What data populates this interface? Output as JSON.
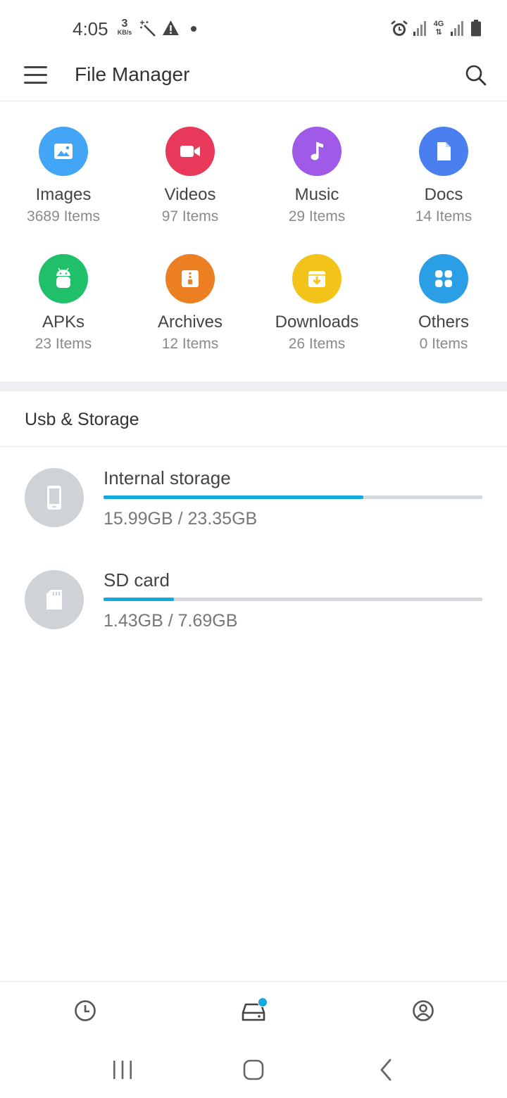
{
  "status_bar": {
    "time": "4:05",
    "net_speed_value": "3",
    "net_speed_unit": "KB/s",
    "network_label": "4G"
  },
  "app_bar": {
    "title": "File Manager"
  },
  "categories": [
    {
      "name": "Images",
      "count": "3689 Items",
      "color": "#42a5f5",
      "icon": "image-icon"
    },
    {
      "name": "Videos",
      "count": "97 Items",
      "color": "#e8395a",
      "icon": "video-icon"
    },
    {
      "name": "Music",
      "count": "29 Items",
      "color": "#a05ae8",
      "icon": "music-note-icon"
    },
    {
      "name": "Docs",
      "count": "14 Items",
      "color": "#4a7ff0",
      "icon": "document-icon"
    },
    {
      "name": "APKs",
      "count": "23 Items",
      "color": "#20c06a",
      "icon": "android-icon"
    },
    {
      "name": "Archives",
      "count": "12 Items",
      "color": "#ec7f22",
      "icon": "archive-icon"
    },
    {
      "name": "Downloads",
      "count": "26 Items",
      "color": "#f2c319",
      "icon": "download-icon"
    },
    {
      "name": "Others",
      "count": "0 Items",
      "color": "#2a9fe6",
      "icon": "grid-icon"
    }
  ],
  "storage_section": {
    "title": "Usb & Storage",
    "items": [
      {
        "name": "Internal storage",
        "usage": "15.99GB / 23.35GB",
        "used_fraction": 0.685,
        "icon": "phone-icon"
      },
      {
        "name": "SD card",
        "usage": "1.43GB / 7.69GB",
        "used_fraction": 0.186,
        "icon": "sd-card-icon"
      }
    ]
  },
  "colors": {
    "accent": "#12a8e0",
    "progress_track": "#d5d8dc",
    "storage_avatar": "#cfd3d7"
  },
  "bottom_nav": {
    "items": [
      "clock-icon",
      "storage-drive-icon",
      "account-icon"
    ],
    "active": "storage-drive-icon"
  },
  "system_nav": [
    "recents-icon",
    "home-icon",
    "back-icon"
  ]
}
